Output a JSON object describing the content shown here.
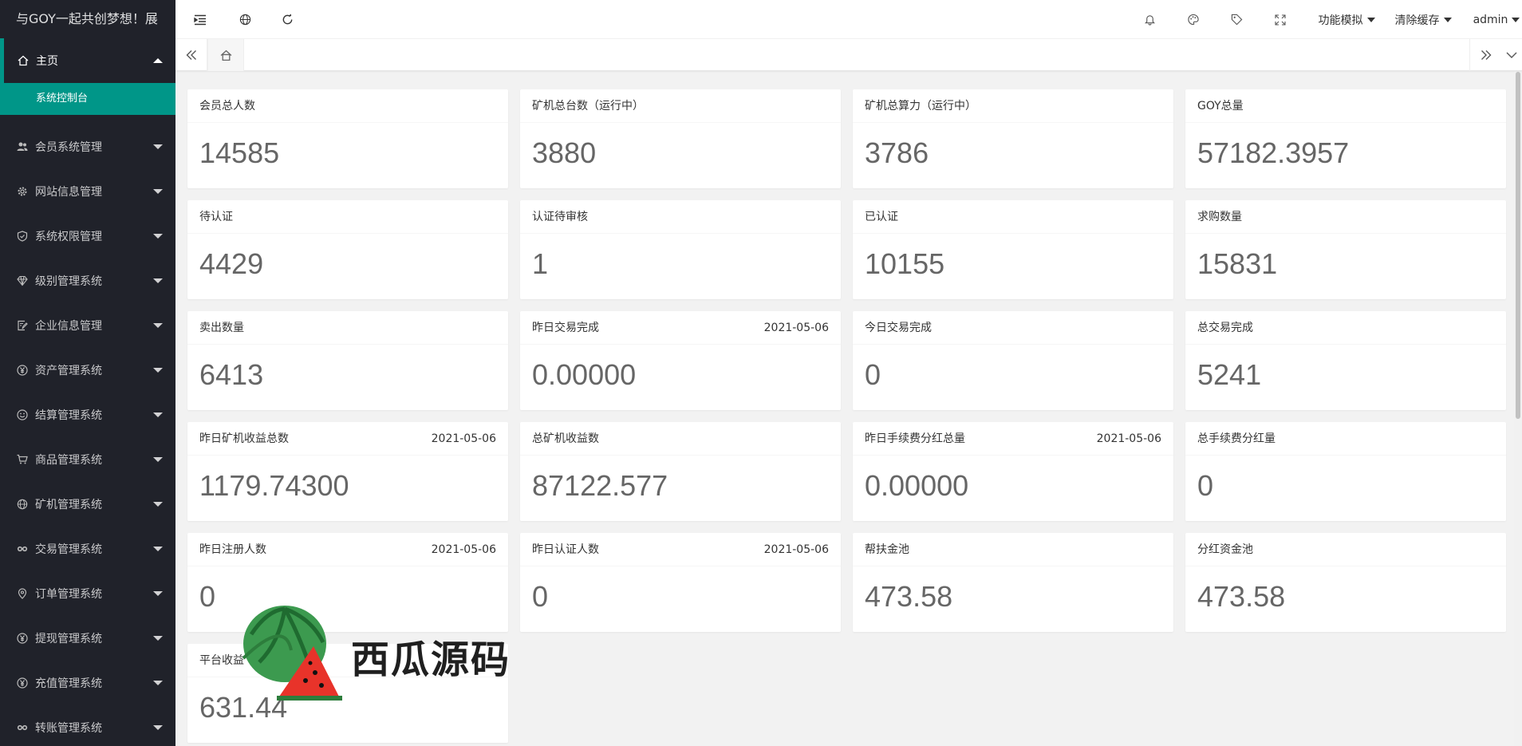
{
  "sidebar": {
    "logo": "与GOY一起共创梦想！展",
    "home": {
      "label": "主页",
      "icon": "home-icon"
    },
    "home_sub": "系统控制台",
    "items": [
      {
        "label": "会员系统管理",
        "icon": "users-icon"
      },
      {
        "label": "网站信息管理",
        "icon": "gear-icon"
      },
      {
        "label": "系统权限管理",
        "icon": "shield-icon"
      },
      {
        "label": "级别管理系统",
        "icon": "diamond-icon"
      },
      {
        "label": "企业信息管理",
        "icon": "edit-doc-icon"
      },
      {
        "label": "资产管理系统",
        "icon": "yen-icon"
      },
      {
        "label": "结算管理系统",
        "icon": "smile-icon"
      },
      {
        "label": "商品管理系统",
        "icon": "cart-icon"
      },
      {
        "label": "矿机管理系统",
        "icon": "globe-icon"
      },
      {
        "label": "交易管理系统",
        "icon": "link-icon"
      },
      {
        "label": "订单管理系统",
        "icon": "location-icon"
      },
      {
        "label": "提现管理系统",
        "icon": "yen-icon"
      },
      {
        "label": "充值管理系统",
        "icon": "yen-icon"
      },
      {
        "label": "转账管理系统",
        "icon": "link-icon"
      }
    ]
  },
  "header": {
    "menu_func": "功能模拟",
    "menu_cache": "清除缓存",
    "user": "admin"
  },
  "cards": [
    {
      "title": "会员总人数",
      "date": "",
      "value": "14585"
    },
    {
      "title": "矿机总台数（运行中）",
      "date": "",
      "value": "3880"
    },
    {
      "title": "矿机总算力（运行中）",
      "date": "",
      "value": "3786"
    },
    {
      "title": "GOY总量",
      "date": "",
      "value": "57182.3957"
    },
    {
      "title": "待认证",
      "date": "",
      "value": "4429"
    },
    {
      "title": "认证待审核",
      "date": "",
      "value": "1"
    },
    {
      "title": "已认证",
      "date": "",
      "value": "10155"
    },
    {
      "title": "求购数量",
      "date": "",
      "value": "15831"
    },
    {
      "title": "卖出数量",
      "date": "",
      "value": "6413"
    },
    {
      "title": "昨日交易完成",
      "date": "2021-05-06",
      "value": "0.00000"
    },
    {
      "title": "今日交易完成",
      "date": "",
      "value": "0"
    },
    {
      "title": "总交易完成",
      "date": "",
      "value": "5241"
    },
    {
      "title": "昨日矿机收益总数",
      "date": "2021-05-06",
      "value": "1179.74300"
    },
    {
      "title": "总矿机收益数",
      "date": "",
      "value": "87122.577"
    },
    {
      "title": "昨日手续费分红总量",
      "date": "2021-05-06",
      "value": "0.00000"
    },
    {
      "title": "总手续费分红量",
      "date": "",
      "value": "0"
    },
    {
      "title": "昨日注册人数",
      "date": "2021-05-06",
      "value": "0"
    },
    {
      "title": "昨日认证人数",
      "date": "2021-05-06",
      "value": "0"
    },
    {
      "title": "帮扶金池",
      "date": "",
      "value": "473.58"
    },
    {
      "title": "分红资金池",
      "date": "",
      "value": "473.58"
    },
    {
      "title": "平台收益",
      "date": "",
      "value": "631.44"
    }
  ],
  "watermark": {
    "text": "西瓜源码"
  },
  "colors": {
    "sidebar_bg": "#20222a",
    "accent": "#009688",
    "page_bg": "#f2f2f2"
  }
}
